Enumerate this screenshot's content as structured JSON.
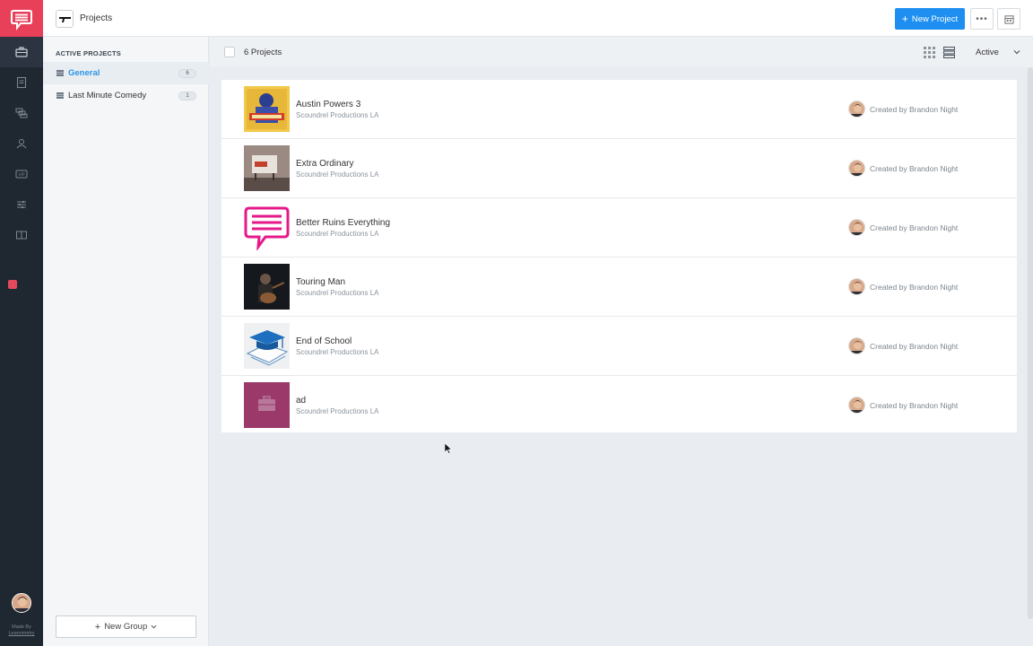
{
  "topbar": {
    "title": "Projects",
    "new_project_label": "New Project"
  },
  "groups": {
    "heading": "ACTIVE PROJECTS",
    "items": [
      {
        "label": "General",
        "count": "6",
        "active": true
      },
      {
        "label": "Last Minute Comedy",
        "count": "1",
        "active": false
      }
    ],
    "new_group_label": "New Group"
  },
  "toolbar": {
    "count_label": "6 Projects",
    "status_filter": "Active"
  },
  "projects": [
    {
      "name": "Austin Powers 3",
      "org": "Scoundrel Productions LA",
      "owner": "Created by Brandon Night",
      "thumb": "movie-poster"
    },
    {
      "name": "Extra Ordinary",
      "org": "Scoundrel Productions LA",
      "owner": "Created by Brandon Night",
      "thumb": "billboard"
    },
    {
      "name": "Better Ruins Everything",
      "org": "Scoundrel Productions LA",
      "owner": "Created by Brandon Night",
      "thumb": "studiobinder-logo"
    },
    {
      "name": "Touring Man",
      "org": "Scoundrel Productions LA",
      "owner": "Created by Brandon Night",
      "thumb": "guitarist-photo"
    },
    {
      "name": "End of School",
      "org": "Scoundrel Productions LA",
      "owner": "Created by Brandon Night",
      "thumb": "graduation-cap"
    },
    {
      "name": "ad",
      "org": "Scoundrel Productions LA",
      "owner": "Created by Brandon Night",
      "thumb": "briefcase-placeholder"
    }
  ],
  "rail": {
    "credit_line1": "Made By",
    "credit_line2": "Leanometry",
    "icons": [
      "projects-icon",
      "documents-icon",
      "shots-icon",
      "contacts-icon",
      "vip-icon",
      "settings-sliders-icon",
      "book-icon"
    ]
  },
  "colors": {
    "brand": "#e9405a",
    "accent": "#1e8ff0",
    "rail_bg": "#1f2730"
  }
}
